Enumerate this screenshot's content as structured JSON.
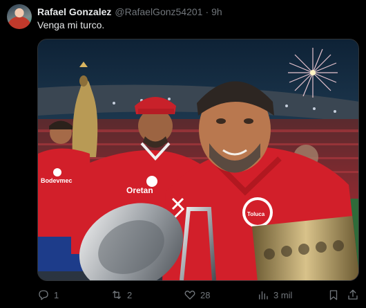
{
  "author": {
    "name": "Rafael Gonzalez",
    "handle": "@RafaelGonz54201",
    "separator": "·",
    "time": "9h"
  },
  "post": {
    "text": "Venga mi turco."
  },
  "image": {
    "shirt_texts": [
      "Bodevmec",
      "Oretan",
      "Toluca"
    ]
  },
  "actions": {
    "reply_count": "1",
    "repost_count": "2",
    "like_count": "28",
    "views_count": "3 mil"
  },
  "icons": [
    "reply-icon",
    "repost-icon",
    "like-icon",
    "views-icon",
    "bookmark-icon",
    "share-icon"
  ],
  "colors": {
    "background": "#000000",
    "text_primary": "#e7e9ea",
    "text_secondary": "#71767b",
    "jersey_red": "#d21f2a"
  }
}
